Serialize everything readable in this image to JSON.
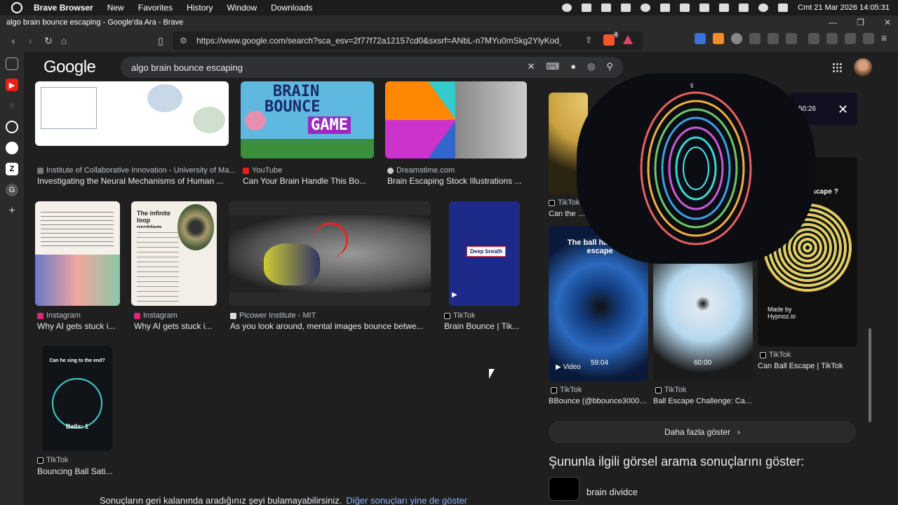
{
  "menubar": {
    "app": "Brave Browser",
    "items": [
      "New",
      "Favorites",
      "History",
      "Window",
      "Downloads"
    ],
    "clock": "Cmt 21 Mar 2026 14:05:31"
  },
  "window": {
    "title": "algo brain bounce escaping - Google'da Ara - Brave"
  },
  "toolbar": {
    "url": "https://www.google.com/search?sca_esv=2f77f72a12157cd0&sxsrf=ANbL-n7MYu0mSkg2YlyKod_jjdRt...",
    "brave_badge": "4"
  },
  "google": {
    "logo": "Google",
    "query": "algo brain bounce escaping"
  },
  "results": [
    {
      "source": "Institute of Collaborative Innovation - University of Ma...",
      "title": "Investigating the Neural Mechanisms of Human ..."
    },
    {
      "source": "YouTube",
      "title": "Can Your Brain Handle This Bo..."
    },
    {
      "source": "Dreamstime.com",
      "title": "Brain Escaping Stock Illustrations ..."
    },
    {
      "source": "Instagram",
      "title": "Why AI gets stuck i..."
    },
    {
      "source": "Instagram",
      "title": "Why AI gets stuck i..."
    },
    {
      "source": "Picower Institute - MIT",
      "title": "As you look around, mental images bounce betwe..."
    },
    {
      "source": "TikTok",
      "title": "Brain Bounce | Tik..."
    },
    {
      "source": "TikTok",
      "title": "Bouncing Ball Sati..."
    }
  ],
  "thumb_text": {
    "brain_bounce_1": "BRAIN",
    "brain_bounce_2": "BOUNCE",
    "brain_bounce_3": "GAME",
    "infinite_loop": "The infinite loop problem",
    "deep_breath": "Deep breath",
    "sing_title": "Can he sing to the end?",
    "balls": "Balls: 1"
  },
  "right_panel": {
    "video_time_top": "50:26",
    "partial_title_top": "e...",
    "tiktok_a_src": "TikTok",
    "tiktok_a_title": "Can the Ba...",
    "ball_has_text": "The ball has 60 to escape",
    "escape_text": "escape ?",
    "hypnoz": "Made by Hypnoz.io",
    "vid1_badge": "Video",
    "vid1_time": "59:04",
    "vid2_time": "60:00",
    "c1_src": "TikTok",
    "c1_title": "BBounce (@bbounce3000)...",
    "c2_src": "TikTok",
    "c2_title": "Ball Escape Challenge: Can...",
    "c3_src": "TikTok",
    "c3_title": "Can Ball Escape | TikTok",
    "more": "Daha fazla göster",
    "related": "Şununla ilgili görsel arama sonuçlarını göster:",
    "related_item": "brain dividce"
  },
  "pip": {
    "counter": "5"
  },
  "bottom_note": {
    "text": "Sonuçların geri kalanında aradığınız şeyi bulamayabilirsiniz.",
    "link": "Diğer sonuçları yine de göster"
  }
}
